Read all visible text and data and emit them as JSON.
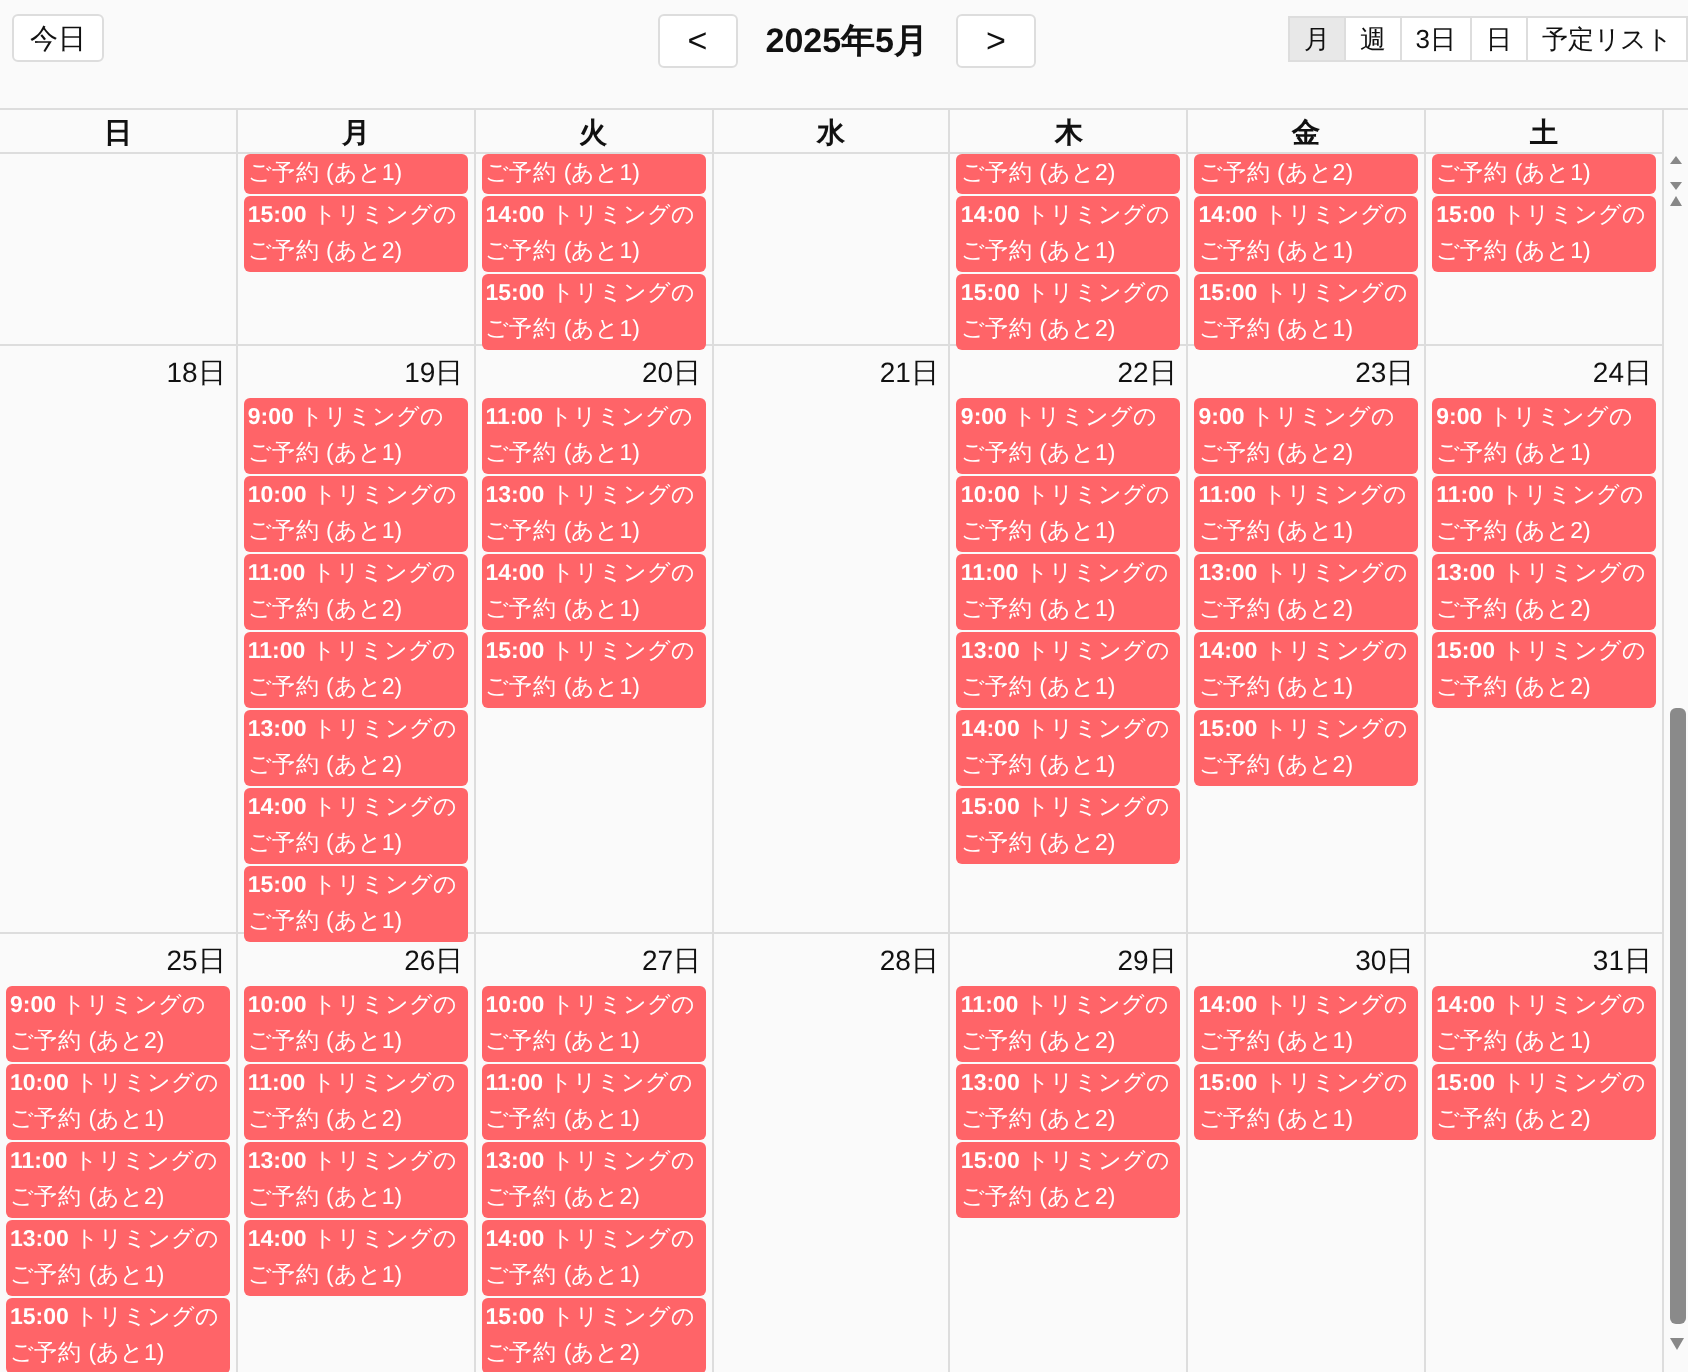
{
  "toolbar": {
    "today": "今日",
    "prev": "<",
    "title": "2025年5月",
    "next": ">",
    "views": [
      {
        "label": "月",
        "selected": true
      },
      {
        "label": "週",
        "selected": false
      },
      {
        "label": "3日",
        "selected": false
      },
      {
        "label": "日",
        "selected": false
      },
      {
        "label": "予定リスト",
        "selected": false
      }
    ]
  },
  "weekdays": [
    "日",
    "月",
    "火",
    "水",
    "木",
    "金",
    "土"
  ],
  "weeks": [
    {
      "partial": true,
      "days": {
        "mon": {
          "events": [
            "ご予約 (あと1)",
            "**15:00** トリミングのご予約 (あと2)"
          ]
        },
        "tue": {
          "events": [
            "ご予約 (あと1)",
            "**14:00** トリミングのご予約 (あと1)",
            "**15:00** トリミングのご予約 (あと1)"
          ]
        },
        "thu": {
          "events": [
            "ご予約 (あと2)",
            "**14:00** トリミングのご予約 (あと1)",
            "**15:00** トリミングのご予約 (あと2)"
          ]
        },
        "fri": {
          "events": [
            "ご予約 (あと2)",
            "**14:00** トリミングのご予約 (あと1)",
            "**15:00** トリミングのご予約 (あと1)"
          ]
        },
        "sat": {
          "events": [
            "ご予約 (あと1)",
            "**15:00** トリミングのご予約 (あと1)"
          ]
        }
      }
    },
    {
      "partial": false,
      "days": {
        "sun": {
          "date": "18日"
        },
        "mon": {
          "date": "19日",
          "events": [
            "**9:00** トリミングのご予約 (あと1)",
            "**10:00** トリミングのご予約 (あと1)",
            "**11:00** トリミングのご予約 (あと2)",
            "**11:00** トリミングのご予約 (あと2)",
            "**13:00** トリミングのご予約 (あと2)",
            "**14:00** トリミングのご予約 (あと1)",
            "**15:00** トリミングのご予約 (あと1)"
          ]
        },
        "tue": {
          "date": "20日",
          "events": [
            "**11:00** トリミングのご予約 (あと1)",
            "**13:00** トリミングのご予約 (あと1)",
            "**14:00** トリミングのご予約 (あと1)",
            "**15:00** トリミングのご予約 (あと1)"
          ]
        },
        "wed": {
          "date": "21日"
        },
        "thu": {
          "date": "22日",
          "events": [
            "**9:00** トリミングのご予約 (あと1)",
            "**10:00** トリミングのご予約 (あと1)",
            "**11:00** トリミングのご予約 (あと1)",
            "**13:00** トリミングのご予約 (あと1)",
            "**14:00** トリミングのご予約 (あと1)",
            "**15:00** トリミングのご予約 (あと2)"
          ]
        },
        "fri": {
          "date": "23日",
          "events": [
            "**9:00** トリミングのご予約 (あと2)",
            "**11:00** トリミングのご予約 (あと1)",
            "**13:00** トリミングのご予約 (あと2)",
            "**14:00** トリミングのご予約 (あと1)",
            "**15:00** トリミングのご予約 (あと2)"
          ]
        },
        "sat": {
          "date": "24日",
          "events": [
            "**9:00** トリミングのご予約 (あと1)",
            "**11:00** トリミングのご予約 (あと2)",
            "**13:00** トリミングのご予約 (あと2)",
            "**15:00** トリミングのご予約 (あと2)"
          ]
        }
      }
    },
    {
      "partial": false,
      "days": {
        "sun": {
          "date": "25日",
          "events": [
            "**9:00** トリミングのご予約 (あと2)",
            "**10:00** トリミングのご予約 (あと1)",
            "**11:00** トリミングのご予約 (あと2)",
            "**13:00** トリミングのご予約 (あと1)",
            "**15:00** トリミングのご予約 (あと1)"
          ]
        },
        "mon": {
          "date": "26日",
          "events": [
            "**10:00** トリミングのご予約 (あと1)",
            "**11:00** トリミングのご予約 (あと2)",
            "**13:00** トリミングのご予約 (あと1)",
            "**14:00** トリミングのご予約 (あと1)"
          ]
        },
        "tue": {
          "date": "27日",
          "events": [
            "**10:00** トリミングのご予約 (あと1)",
            "**11:00** トリミングのご予約 (あと1)",
            "**13:00** トリミングのご予約 (あと2)",
            "**14:00** トリミングのご予約 (あと1)",
            "**15:00** トリミングのご予約 (あと2)"
          ]
        },
        "wed": {
          "date": "28日"
        },
        "thu": {
          "date": "29日",
          "events": [
            "**11:00** トリミングのご予約 (あと2)",
            "**13:00** トリミングのご予約 (あと2)",
            "**15:00** トリミングのご予約 (あと2)"
          ]
        },
        "fri": {
          "date": "30日",
          "events": [
            "**14:00** トリミングのご予約 (あと1)",
            "**15:00** トリミングのご予約 (あと1)"
          ]
        },
        "sat": {
          "date": "31日",
          "events": [
            "**14:00** トリミングのご予約 (あと1)",
            "**15:00** トリミングのご予約 (あと2)"
          ]
        }
      }
    }
  ]
}
